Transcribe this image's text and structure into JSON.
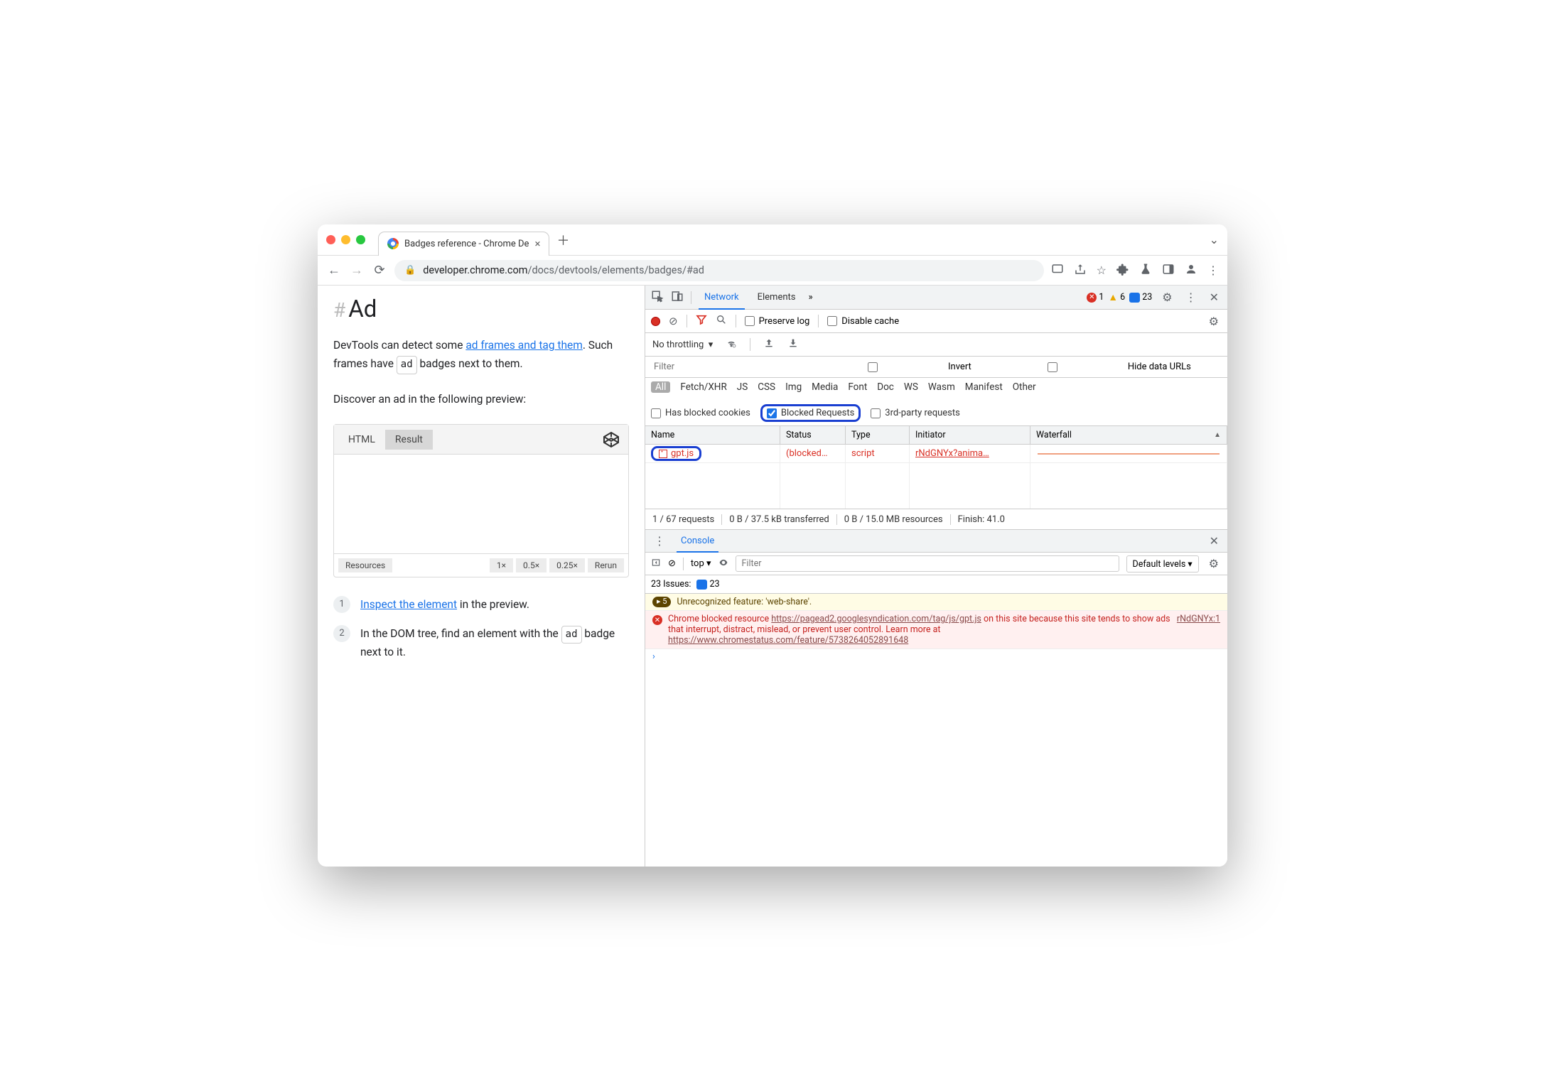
{
  "tab": {
    "title": "Badges reference - Chrome De"
  },
  "url": {
    "host": "developer.chrome.com",
    "path": "/docs/devtools/elements/badges/#ad"
  },
  "page": {
    "heading": "Ad",
    "p1_pre": "DevTools can detect some ",
    "p1_link": "ad frames and tag them",
    "p1_mid": ". Such frames have ",
    "p1_badge": "ad",
    "p1_post": " badges next to them.",
    "p2": "Discover an ad in the following preview:",
    "cp_tabs": [
      "HTML",
      "Result"
    ],
    "cp_footer": [
      "Resources",
      "1×",
      "0.5×",
      "0.25×",
      "Rerun"
    ],
    "step1_link": "Inspect the element",
    "step1_post": " in the preview.",
    "step2_pre": "In the DOM tree, find an element with the ",
    "step2_badge": "ad",
    "step2_post": " badge next to it."
  },
  "devtools": {
    "tabs": {
      "network": "Network",
      "elements": "Elements"
    },
    "status": {
      "errors": "1",
      "warnings": "6",
      "messages": "23"
    },
    "nettoolbar": {
      "preserve": "Preserve log",
      "disable": "Disable cache"
    },
    "throttle": "No throttling",
    "filter_placeholder": "Filter",
    "invert": "Invert",
    "hide": "Hide data URLs",
    "types": [
      "All",
      "Fetch/XHR",
      "JS",
      "CSS",
      "Img",
      "Media",
      "Font",
      "Doc",
      "WS",
      "Wasm",
      "Manifest",
      "Other"
    ],
    "chk_blocked_cookies": "Has blocked cookies",
    "chk_blocked_req": "Blocked Requests",
    "chk_3rd": "3rd-party requests",
    "cols": {
      "name": "Name",
      "status": "Status",
      "type": "Type",
      "initiator": "Initiator",
      "waterfall": "Waterfall"
    },
    "rows": [
      {
        "name": "gpt.js",
        "status": "(blocked…",
        "type": "script",
        "initiator": "rNdGNYx?anima…"
      }
    ],
    "summary": [
      "1 / 67 requests",
      "0 B / 37.5 kB transferred",
      "0 B / 15.0 MB resources",
      "Finish: 41.0"
    ]
  },
  "console": {
    "tab": "Console",
    "context": "top",
    "filter_placeholder": "Filter",
    "levels": "Default levels",
    "issues_label": "23 Issues:",
    "issues_count": "23",
    "warn_badge": "5",
    "warn_text": "Unrecognized feature: 'web-share'.",
    "err_pre": "Chrome blocked resource ",
    "err_url1": "https://pagead2.googlesyndication.com/tag/js/gpt.js",
    "err_mid": " on this site because this site tends to show ads that interrupt, distract, mislead, or prevent user control. Learn more at ",
    "err_url2": "https://www.chromestatus.com/feature/5738264052891648",
    "err_src": "rNdGNYx:1"
  }
}
